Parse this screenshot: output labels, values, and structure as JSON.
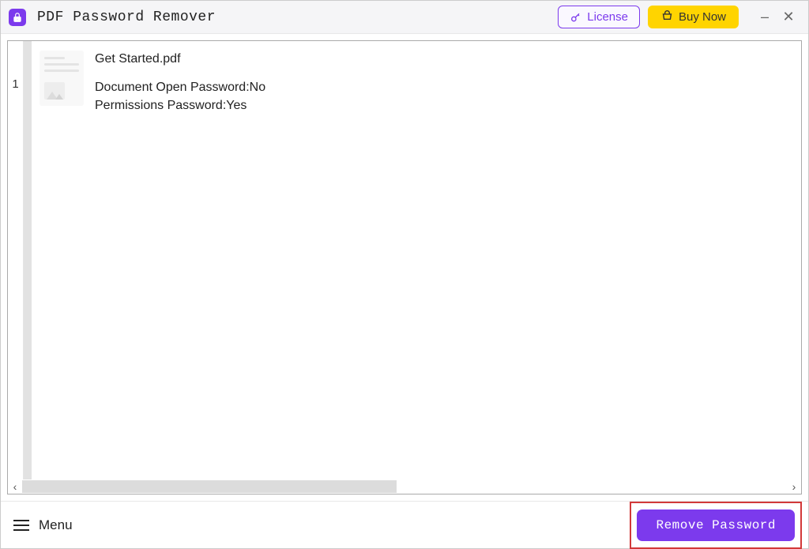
{
  "app": {
    "title": "PDF Password Remover"
  },
  "header": {
    "license_label": "License",
    "buy_label": "Buy Now"
  },
  "files": [
    {
      "index": "1",
      "name": "Get Started.pdf",
      "open_pw_label": "Document Open Password:",
      "open_pw_value": "No",
      "perm_pw_label": "Permissions Password:",
      "perm_pw_value": "Yes"
    }
  ],
  "footer": {
    "menu_label": "Menu",
    "remove_label": "Remove Password"
  }
}
